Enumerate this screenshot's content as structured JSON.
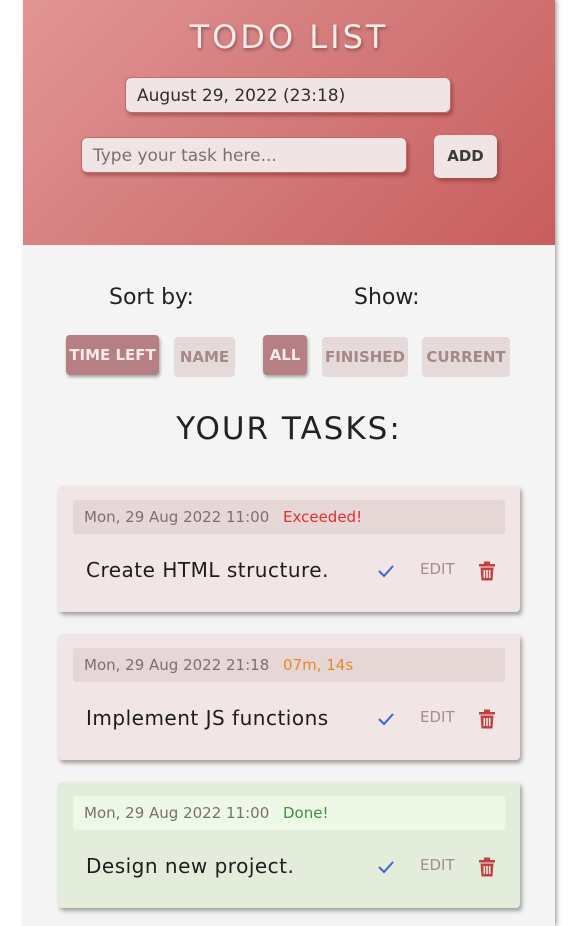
{
  "header": {
    "title": "TODO LIST",
    "date_value": "August 29, 2022 (23:18)",
    "task_input_placeholder": "Type your task here...",
    "add_label": "ADD"
  },
  "controls": {
    "sort_label": "Sort by:",
    "show_label": "Show:",
    "sort_options": [
      "TIME LEFT",
      "NAME"
    ],
    "sort_selected": "TIME LEFT",
    "show_options": [
      "ALL",
      "FINISHED",
      "CURRENT"
    ],
    "show_selected": "ALL"
  },
  "tasks_heading": "YOUR TASKS:",
  "tasks": [
    {
      "deadline": "Mon, 29 Aug 2022 11:00",
      "status": "Exceeded!",
      "status_color": "#e0302f",
      "text": "Create HTML structure.",
      "edit_label": "EDIT",
      "state": "late"
    },
    {
      "deadline": "Mon, 29 Aug 2022 21:18",
      "status": "07m, 14s",
      "status_color": "#e8882b",
      "text": "Implement JS functions",
      "edit_label": "EDIT",
      "state": "late"
    },
    {
      "deadline": "Mon, 29 Aug 2022 11:00",
      "status": "Done!",
      "status_color": "#3f8f3f",
      "text": "Design new project.",
      "edit_label": "EDIT",
      "state": "done"
    }
  ],
  "colors": {
    "check": "#3a63d6",
    "trash": "#c0413f"
  }
}
